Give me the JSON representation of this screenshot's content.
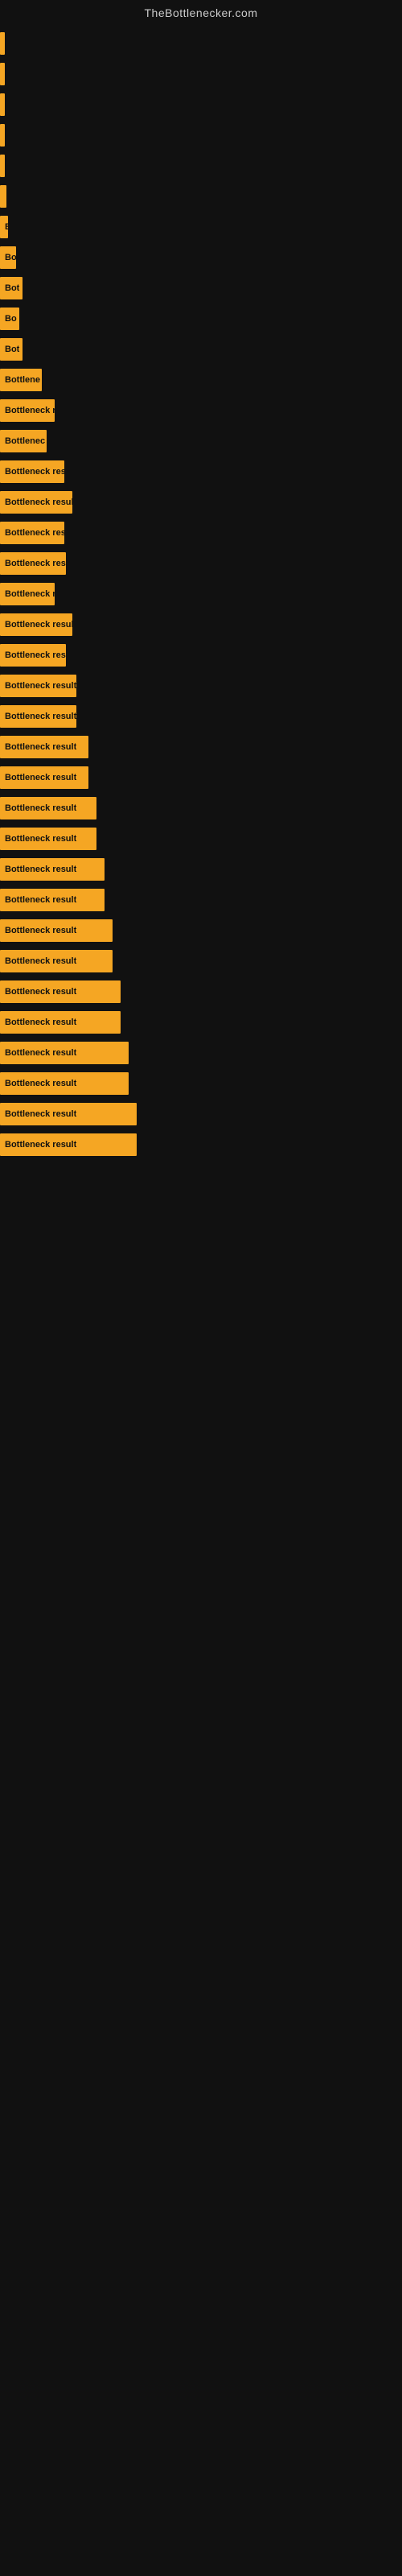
{
  "site": {
    "title": "TheBottlenecker.com"
  },
  "bars": [
    {
      "id": 1,
      "width": 4,
      "label": ""
    },
    {
      "id": 2,
      "width": 4,
      "label": ""
    },
    {
      "id": 3,
      "width": 6,
      "label": ""
    },
    {
      "id": 4,
      "width": 4,
      "label": ""
    },
    {
      "id": 5,
      "width": 4,
      "label": ""
    },
    {
      "id": 6,
      "width": 8,
      "label": ""
    },
    {
      "id": 7,
      "width": 10,
      "label": "B"
    },
    {
      "id": 8,
      "width": 20,
      "label": "Bo"
    },
    {
      "id": 9,
      "width": 28,
      "label": "Bot"
    },
    {
      "id": 10,
      "width": 24,
      "label": "Bo"
    },
    {
      "id": 11,
      "width": 28,
      "label": "Bot"
    },
    {
      "id": 12,
      "width": 52,
      "label": "Bottlene"
    },
    {
      "id": 13,
      "width": 68,
      "label": "Bottleneck re"
    },
    {
      "id": 14,
      "width": 58,
      "label": "Bottlenec"
    },
    {
      "id": 15,
      "width": 80,
      "label": "Bottleneck res"
    },
    {
      "id": 16,
      "width": 90,
      "label": "Bottleneck result"
    },
    {
      "id": 17,
      "width": 80,
      "label": "Bottleneck res"
    },
    {
      "id": 18,
      "width": 82,
      "label": "Bottleneck resul"
    },
    {
      "id": 19,
      "width": 68,
      "label": "Bottleneck r"
    },
    {
      "id": 20,
      "width": 90,
      "label": "Bottleneck result"
    },
    {
      "id": 21,
      "width": 82,
      "label": "Bottleneck resu"
    },
    {
      "id": 22,
      "width": 95,
      "label": "Bottleneck result"
    },
    {
      "id": 23,
      "width": 95,
      "label": "Bottleneck result"
    },
    {
      "id": 24,
      "width": 110,
      "label": "Bottleneck result"
    },
    {
      "id": 25,
      "width": 110,
      "label": "Bottleneck result"
    },
    {
      "id": 26,
      "width": 120,
      "label": "Bottleneck result"
    },
    {
      "id": 27,
      "width": 120,
      "label": "Bottleneck result"
    },
    {
      "id": 28,
      "width": 130,
      "label": "Bottleneck result"
    },
    {
      "id": 29,
      "width": 130,
      "label": "Bottleneck result"
    },
    {
      "id": 30,
      "width": 140,
      "label": "Bottleneck result"
    },
    {
      "id": 31,
      "width": 140,
      "label": "Bottleneck result"
    },
    {
      "id": 32,
      "width": 150,
      "label": "Bottleneck result"
    },
    {
      "id": 33,
      "width": 150,
      "label": "Bottleneck result"
    },
    {
      "id": 34,
      "width": 160,
      "label": "Bottleneck result"
    },
    {
      "id": 35,
      "width": 160,
      "label": "Bottleneck result"
    },
    {
      "id": 36,
      "width": 170,
      "label": "Bottleneck result"
    },
    {
      "id": 37,
      "width": 170,
      "label": "Bottleneck result"
    }
  ]
}
